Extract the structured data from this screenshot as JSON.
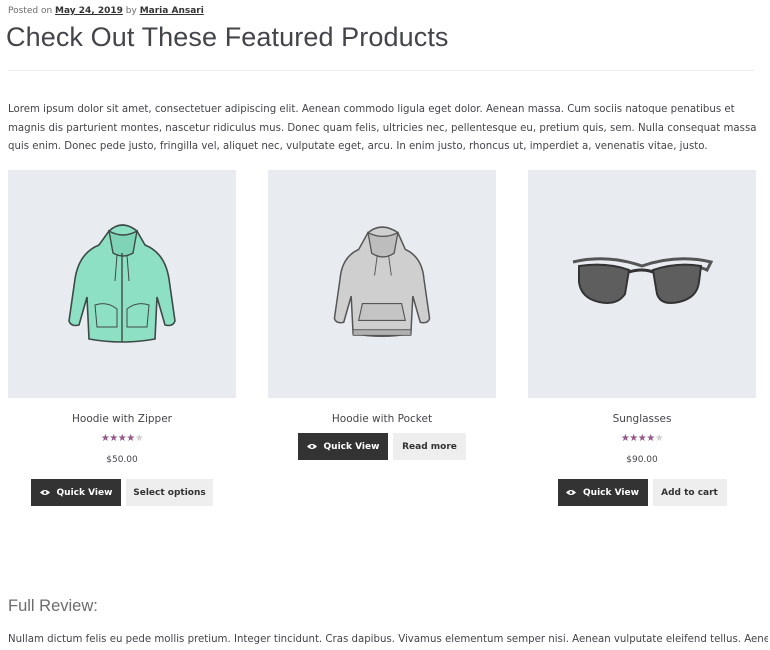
{
  "post": {
    "posted_on_label": "Posted on",
    "date": "May 24, 2019",
    "by_label": "by",
    "author": "Maria Ansari"
  },
  "title": "Check Out These Featured Products",
  "intro": "Lorem ipsum dolor sit amet, consectetuer adipiscing elit. Aenean commodo ligula eget dolor. Aenean massa. Cum sociis natoque penatibus et magnis dis parturient montes, nascetur ridiculus mus. Donec quam felis, ultricies nec, pellentesque eu, pretium quis, sem. Nulla consequat massa quis enim. Donec pede justo, fringilla vel, aliquet nec, vulputate eget, arcu. In enim justo, rhoncus ut, imperdiet a, venenatis vitae, justo.",
  "products": [
    {
      "name": "Hoodie with Zipper",
      "rating": 4,
      "rating_max": 5,
      "price": "$50.00",
      "quick_view": "Quick View",
      "action": "Select options",
      "image_icon": "zip-hoodie-icon",
      "image_color": "#8ee0c4"
    },
    {
      "name": "Hoodie with Pocket",
      "quick_view": "Quick View",
      "action": "Read more",
      "image_icon": "pocket-hoodie-icon",
      "image_color": "#cfcfcf"
    },
    {
      "name": "Sunglasses",
      "rating": 4,
      "rating_max": 5,
      "price": "$90.00",
      "quick_view": "Quick View",
      "action": "Add to cart",
      "image_icon": "sunglasses-icon",
      "image_color": "#6b6b6b"
    }
  ],
  "review": {
    "heading": "Full Review:",
    "text": "Nullam dictum felis eu pede mollis pretium. Integer tincidunt. Cras dapibus. Vivamus elementum semper nisi. Aenean vulputate eleifend tellus. Aenean leo"
  },
  "colors": {
    "star": "#96588a",
    "star_empty": "#d3ced2",
    "button_dark": "#333333",
    "button_light": "#eeeeee",
    "image_bg": "#e8ecf1"
  }
}
